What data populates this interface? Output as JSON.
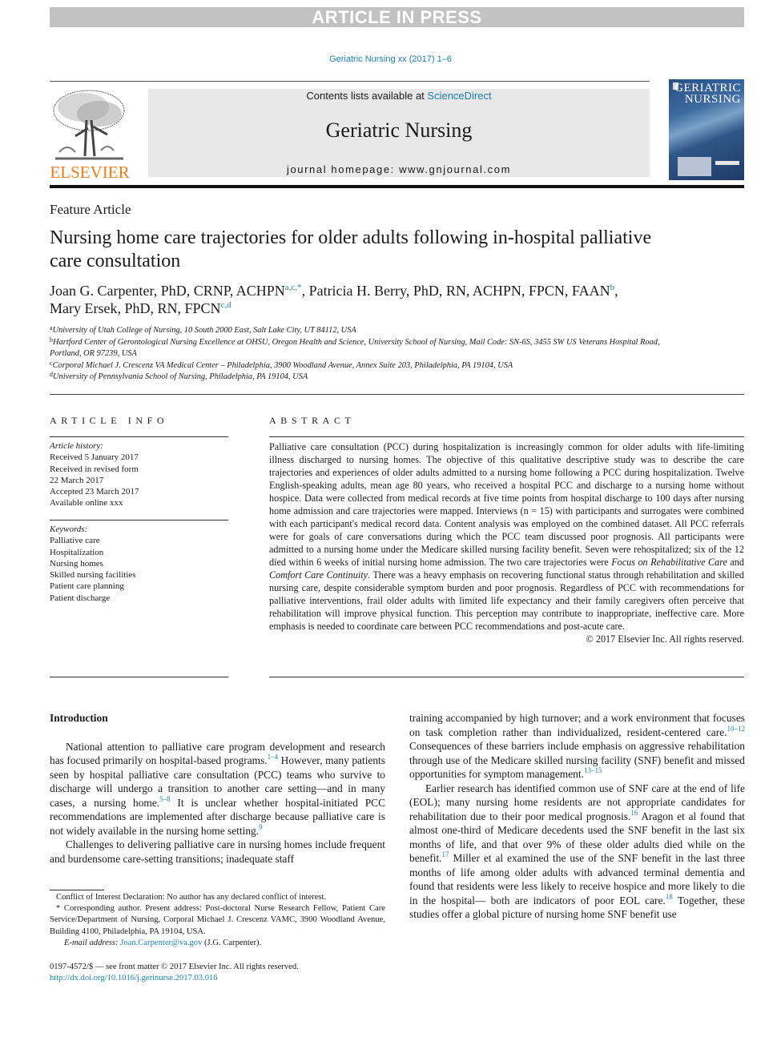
{
  "banner": "ARTICLE IN PRESS",
  "journal_ref": "Geriatric Nursing xx (2017) 1–6",
  "header": {
    "publisher_logo": "ELSEVIER",
    "contents_prefix": "Contents lists available at ",
    "contents_link": "ScienceDirect",
    "journal_title": "Geriatric Nursing",
    "homepage": "journal homepage: www.gnjournal.com",
    "cover_title_line1": "GERIATRIC",
    "cover_title_line2": "NURSING"
  },
  "article_type": "Feature Article",
  "title": "Nursing home care trajectories for older adults following in-hospital palliative care consultation",
  "authors": [
    {
      "name": "Joan G. Carpenter, PhD, CRNP, ACHPN",
      "affil": "a,c,*",
      "sep": ", "
    },
    {
      "name": "Patricia H. Berry, PhD, RN, ACHPN, FPCN, FAAN",
      "affil": "b",
      "sep": ","
    },
    {
      "name": "Mary Ersek, PhD, RN, FPCN",
      "affil": "c,d",
      "sep": ""
    }
  ],
  "affiliations": [
    {
      "key": "a",
      "text": "University of Utah College of Nursing, 10 South 2000 East, Salt Lake City, UT 84112, USA"
    },
    {
      "key": "b",
      "text": "Hartford Center of Gerontological Nursing Excellence at OHSU, Oregon Health and Science, University School of Nursing, Mail Code: SN-6S, 3455 SW US Veterans Hospital Road, Portland, OR 97239, USA"
    },
    {
      "key": "c",
      "text": "Corporal Michael J. Crescenz VA Medical Center – Philadelphia, 3900 Woodland Avenue, Annex Suite 203, Philadelphia, PA 19104, USA"
    },
    {
      "key": "d",
      "text": "University of Pennsylvania School of Nursing, Philadelphia, PA 19104, USA"
    }
  ],
  "article_info": {
    "heading": "ARTICLE INFO",
    "history_label": "Article history:",
    "history": [
      "Received 5 January 2017",
      "Received in revised form",
      "22 March 2017",
      "Accepted 23 March 2017",
      "Available online xxx"
    ],
    "keywords_label": "Keywords:",
    "keywords": [
      "Palliative care",
      "Hospitalization",
      "Nursing homes",
      "Skilled nursing facilities",
      "Patient care planning",
      "Patient discharge"
    ]
  },
  "abstract": {
    "heading": "ABSTRACT",
    "part1": "Palliative care consultation (PCC) during hospitalization is increasingly common for older adults with life-limiting illness discharged to nursing homes. The objective of this qualitative descriptive study was to describe the care trajectories and experiences of older adults admitted to a nursing home following a PCC during hospitalization. Twelve English-speaking adults, mean age 80 years, who received a hospital PCC and discharge to a nursing home without hospice. Data were collected from medical records at five time points from hospital discharge to 100 days after nursing home admission and care trajectories were mapped. Interviews (n = 15) with participants and surrogates were combined with each participant's medical record data. Content analysis was employed on the combined dataset. All PCC referrals were for goals of care conversations during which the PCC team discussed poor prognosis. All participants were admitted to a nursing home under the Medicare skilled nursing facility benefit. Seven were rehospitalized; six of the 12 died within 6 weeks of initial nursing home admission. The two care trajectories were ",
    "italic1": "Focus on Rehabilitative Care",
    "and": " and ",
    "italic2": "Comfort Care Continuity",
    "part2": ". There was a heavy emphasis on recovering functional status through rehabilitation and skilled nursing care, despite considerable symptom burden and poor prognosis. Regardless of PCC with recommendations for palliative interventions, frail older adults with limited life expectancy and their family caregivers often perceive that rehabilitation will improve physical function. This perception may contribute to inappropriate, ineffective care. More emphasis is needed to coordinate care between PCC recommendations and post-acute care.",
    "copyright": "© 2017 Elsevier Inc. All rights reserved."
  },
  "body": {
    "intro_heading": "Introduction",
    "left_p1": [
      {
        "t": "National attention to palliative care program development and research has focused primarily on hospital-based programs."
      },
      {
        "ref": "1–4"
      },
      {
        "t": " However, many patients seen by hospital palliative care consultation (PCC) teams who survive to discharge will undergo a transition to another care setting—and in many cases, a nursing home."
      },
      {
        "ref": "5–8"
      },
      {
        "t": " It is unclear whether hospital-initiated PCC recommendations are implemented after discharge because palliative care is not widely available in the nursing home setting."
      },
      {
        "ref": "9"
      }
    ],
    "left_p2": "Challenges to delivering palliative care in nursing homes include frequent and burdensome care-setting transitions; inadequate staff",
    "right_p1": [
      {
        "t": "training accompanied by high turnover; and a work environment that focuses on task completion rather than individualized, resident-centered care."
      },
      {
        "ref": "10–12"
      },
      {
        "t": " Consequences of these barriers include emphasis on aggressive rehabilitation through use of the Medicare skilled nursing facility (SNF) benefit and missed opportunities for symptom management."
      },
      {
        "ref": "13–15"
      }
    ],
    "right_p2": [
      {
        "t": "Earlier research has identified common use of SNF care at the end of life (EOL); many nursing home residents are not appropriate candidates for rehabilitation due to their poor medical prognosis."
      },
      {
        "ref": "16"
      },
      {
        "t": " Aragon et al found that almost one-third of Medicare decedents used the SNF benefit in the last six months of life, and that over 9% of these older adults died while on the benefit."
      },
      {
        "ref": "17"
      },
      {
        "t": " Miller et al examined the use of the SNF benefit in the last three months of life among older adults with advanced terminal dementia and found that residents were less likely to receive hospice and more likely to die in the hospital— both are indicators of poor EOL care."
      },
      {
        "ref": "18"
      },
      {
        "t": " Together, these studies offer a global picture of nursing home SNF benefit use"
      }
    ]
  },
  "footnotes": {
    "conflict": "Conflict of Interest Declaration: No author has any declared conflict of interest.",
    "corresponding": "* Corresponding author. Present address: Post-doctoral Nurse Research Fellow, Patient Care Service/Department of Nursing, Corporal Michael J. Crescenz VAMC, 3900 Woodland Avenue, Building 4100, Philadelphia, PA 19104, USA.",
    "email_label": "E-mail address: ",
    "email": "Joan.Carpenter@va.gov",
    "email_suffix": " (J.G. Carpenter)."
  },
  "bottom": {
    "issn": "0197-4572/$ — see front matter © 2017 Elsevier Inc. All rights reserved.",
    "doi": "http://dx.doi.org/10.1016/j.gerinurse.2017.03.016"
  },
  "colors": {
    "link": "#1d7fb0",
    "elsevier_orange": "#f07d1c",
    "banner_gray": "#c2c2c2"
  }
}
